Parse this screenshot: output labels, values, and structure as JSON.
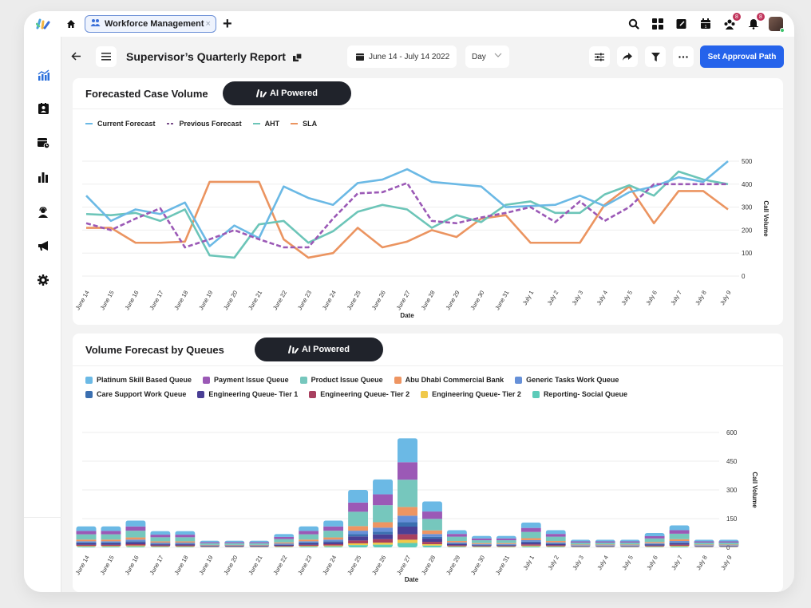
{
  "topbar": {
    "tab_label": "Workforce Management",
    "tab_close": "×",
    "new_tab": "+",
    "icons": [
      "search-icon",
      "apps-grid-icon",
      "compose-icon",
      "calendar-icon",
      "team-icon",
      "bell-icon",
      "avatar"
    ],
    "badges": {
      "team": "8",
      "bell": "8"
    }
  },
  "sidebar": {
    "items": [
      {
        "name": "analytics",
        "active": true
      },
      {
        "name": "contacts",
        "active": false
      },
      {
        "name": "schedule",
        "active": false
      },
      {
        "name": "reports",
        "active": false
      },
      {
        "name": "agent",
        "active": false
      },
      {
        "name": "campaigns",
        "active": false
      },
      {
        "name": "settings",
        "active": false
      }
    ]
  },
  "header": {
    "title": "Supervisor’s Quarterly Report",
    "date_range": "June 14 - July 14 2022",
    "granularity": "Day",
    "approval_button": "Set Approval Path"
  },
  "colors": {
    "accent": "#2563eb",
    "pill": "#20232b",
    "current": "#6bb9e5",
    "previous": "#9b59b6",
    "aht": "#6cc5b8",
    "sla": "#eb9460"
  },
  "card1": {
    "title": "Forecasted Case Volume",
    "ai_label": "AI Powered"
  },
  "card2": {
    "title": "Volume Forecast by Queues",
    "ai_label": "AI Powered"
  },
  "chart_data": [
    {
      "type": "line",
      "title": "Forecasted Case Volume",
      "xlabel": "Date",
      "ylabel": "Call Volume",
      "ylim": [
        0,
        500
      ],
      "yticks": [
        0,
        100,
        200,
        300,
        400,
        500
      ],
      "grid": true,
      "legend": "top-left",
      "categories": [
        "June 14",
        "June 15",
        "June 16",
        "June 17",
        "June 18",
        "June 19",
        "June 20",
        "June 21",
        "June 22",
        "June 23",
        "June 24",
        "June 25",
        "June 26",
        "June 27",
        "June 28",
        "June 29",
        "June 30",
        "June 31",
        "July 1",
        "July 2",
        "July 3",
        "July 4",
        "July 5",
        "July 6",
        "July 7",
        "July 8",
        "July 9"
      ],
      "series": [
        {
          "name": "Current Forecast",
          "style": "solid",
          "values": [
            350,
            240,
            290,
            270,
            320,
            130,
            220,
            165,
            390,
            340,
            310,
            405,
            420,
            465,
            410,
            400,
            390,
            300,
            305,
            310,
            350,
            305,
            365,
            390,
            430,
            410,
            500
          ]
        },
        {
          "name": "Previous Forecast",
          "style": "dashed",
          "values": [
            230,
            200,
            250,
            295,
            125,
            160,
            200,
            160,
            125,
            125,
            250,
            360,
            365,
            405,
            240,
            230,
            255,
            275,
            300,
            235,
            325,
            240,
            300,
            400,
            400,
            400,
            400
          ]
        },
        {
          "name": "AHT",
          "style": "solid",
          "values": [
            270,
            265,
            275,
            240,
            290,
            90,
            80,
            225,
            240,
            145,
            195,
            280,
            310,
            290,
            210,
            265,
            235,
            310,
            325,
            275,
            275,
            355,
            395,
            350,
            455,
            420,
            400
          ]
        },
        {
          "name": "SLA",
          "style": "solid",
          "values": [
            210,
            210,
            145,
            145,
            150,
            410,
            410,
            410,
            160,
            80,
            100,
            210,
            125,
            150,
            200,
            170,
            250,
            265,
            145,
            145,
            145,
            310,
            390,
            230,
            370,
            370,
            290
          ]
        }
      ]
    },
    {
      "type": "bar",
      "stacked": true,
      "title": "Volume Forecast by Queues",
      "xlabel": "Date",
      "ylabel": "Call Volume",
      "ylim": [
        0,
        600
      ],
      "yticks": [
        0,
        150,
        300,
        450,
        600
      ],
      "grid": true,
      "legend": "top-left",
      "categories": [
        "June 14",
        "June 15",
        "June 16",
        "June 17",
        "June 18",
        "June 19",
        "June 20",
        "June 21",
        "June 22",
        "June 23",
        "June 24",
        "June 25",
        "June 26",
        "June 27",
        "June 28",
        "June 29",
        "June 30",
        "June 31",
        "July 1",
        "July 2",
        "July 3",
        "July 4",
        "July 5",
        "July 6",
        "July 7",
        "July 8",
        "July 9"
      ],
      "totals": [
        110,
        110,
        140,
        85,
        85,
        35,
        35,
        35,
        70,
        110,
        140,
        300,
        355,
        570,
        240,
        90,
        60,
        60,
        130,
        90,
        40,
        40,
        40,
        75,
        115,
        40,
        40
      ],
      "series": [
        {
          "name": "Platinum Skill Based Queue",
          "color": "#6bb9e5"
        },
        {
          "name": "Payment Issue Queue",
          "color": "#9b59b6"
        },
        {
          "name": "Product Issue Queue",
          "color": "#76c7bd"
        },
        {
          "name": "Abu Dhabi Commercial Bank",
          "color": "#ee9562"
        },
        {
          "name": "Generic Tasks Work Queue",
          "color": "#6690d8"
        },
        {
          "name": "Care Support Work Queue",
          "color": "#3b6fb0"
        },
        {
          "name": "Engineering Queue- Tier 1",
          "color": "#4a3f95"
        },
        {
          "name": "Engineering Queue- Tier 2",
          "color": "#a8405f"
        },
        {
          "name": "Engineering Queue- Tier 2",
          "color": "#f0c94a"
        },
        {
          "name": "Reporting- Social Queue",
          "color": "#5ccbb9"
        }
      ],
      "share": [
        0.22,
        0.16,
        0.25,
        0.08,
        0.06,
        0.04,
        0.07,
        0.05,
        0.03,
        0.04
      ]
    }
  ]
}
